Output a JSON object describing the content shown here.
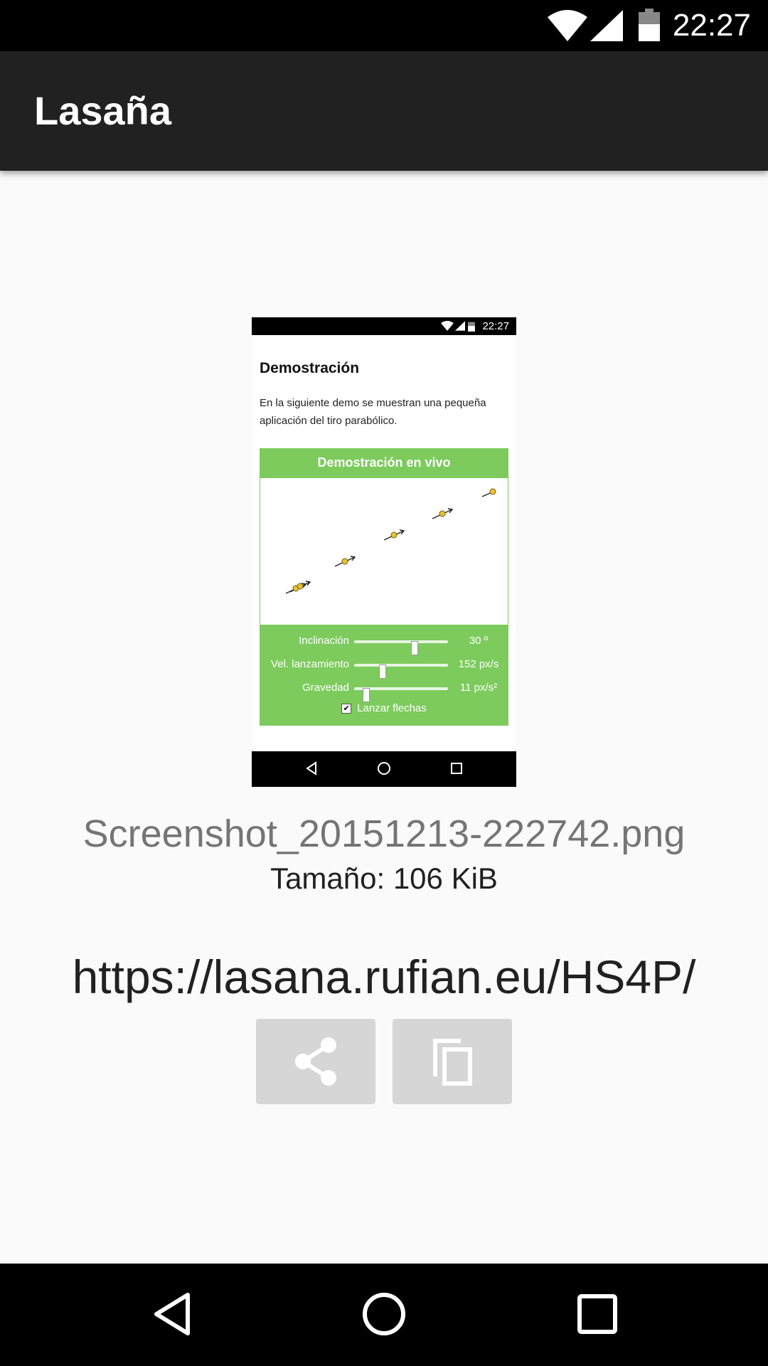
{
  "status_bar": {
    "time": "22:27",
    "icons": [
      "wifi-icon",
      "cellular-signal-icon",
      "battery-icon"
    ]
  },
  "app_bar": {
    "title": "Lasaña"
  },
  "preview": {
    "status_time": "22:27",
    "heading": "Demostración",
    "paragraph": "En la siguiente demo se muestran una pequeña aplicación del tiro parabólico.",
    "panel_title": "Demostración en vivo",
    "controls": [
      {
        "label": "Inclinación",
        "value": "30 º",
        "level": 0.64
      },
      {
        "label": "Vel. lanzamiento",
        "value": "152 px/s",
        "level": 0.3
      },
      {
        "label": "Gravedad",
        "value": "11 px/s²",
        "level": 0.13
      }
    ],
    "checkbox_label": "Lanzar flechas",
    "checkbox_checked": true
  },
  "file": {
    "name": "Screenshot_20151213-222742.png",
    "size": "Tamaño: 106 KiB"
  },
  "link": {
    "url": "https://lasana.rufian.eu/HS4P/"
  },
  "actions": {
    "share_icon": "share-icon",
    "copy_icon": "copy-icon"
  },
  "colors": {
    "app_bar": "#212121",
    "panel_green": "#7dcb5d",
    "button_bg": "#d6d6d6"
  }
}
